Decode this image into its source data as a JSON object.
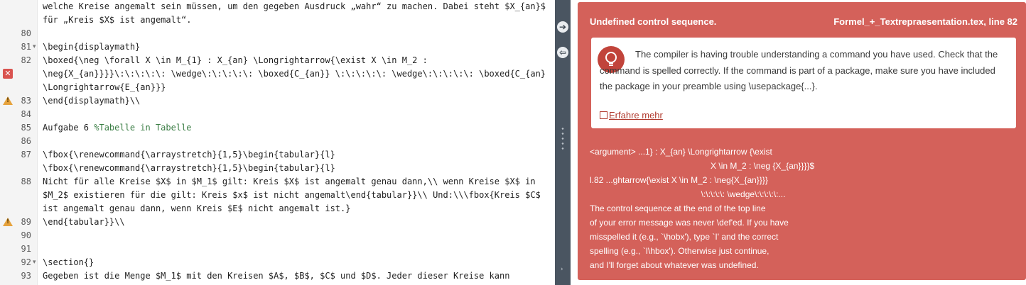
{
  "editor": {
    "lines": [
      {
        "num": "",
        "fold": "",
        "icon": "",
        "code": "welche Kreise angemalt sein müssen, um den gegeben Ausdruck „wahr“ zu machen. Dabei steht $X_{an}$"
      },
      {
        "num": "",
        "fold": "",
        "icon": "",
        "code": "für „Kreis $X$ ist angemalt“."
      },
      {
        "num": "80",
        "fold": "",
        "icon": "",
        "code": ""
      },
      {
        "num": "81",
        "fold": "▾",
        "icon": "",
        "code": "\\begin{displaymath}"
      },
      {
        "num": "82",
        "fold": "",
        "icon": "",
        "code": "\\boxed{\\neg \\forall X \\in M_{1} : X_{an} \\Longrightarrow{\\exist X \\in M_2 :"
      },
      {
        "num": "",
        "fold": "",
        "icon": "error",
        "code": "\\neg{X_{an}}}}\\:\\:\\:\\:\\: \\wedge\\:\\:\\:\\:\\: \\boxed{C_{an}} \\:\\:\\:\\:\\: \\wedge\\:\\:\\:\\:\\: \\boxed{C_{an}"
      },
      {
        "num": "",
        "fold": "",
        "icon": "",
        "code": "\\Longrightarrow{E_{an}}}"
      },
      {
        "num": "83",
        "fold": "",
        "icon": "warning",
        "code": "\\end{displaymath}\\\\"
      },
      {
        "num": "84",
        "fold": "",
        "icon": "",
        "code": ""
      },
      {
        "num": "85",
        "fold": "",
        "icon": "",
        "code": "Aufgabe 6 %Tabelle in Tabelle"
      },
      {
        "num": "86",
        "fold": "",
        "icon": "",
        "code": ""
      },
      {
        "num": "87",
        "fold": "",
        "icon": "",
        "code": "\\fbox{\\renewcommand{\\arraystretch}{1,5}\\begin{tabular}{l}"
      },
      {
        "num": "",
        "fold": "",
        "icon": "",
        "code": "\\fbox{\\renewcommand{\\arraystretch}{1,5}\\begin{tabular}{l}"
      },
      {
        "num": "88",
        "fold": "",
        "icon": "",
        "code": "Nicht für alle Kreise $X$ in $M_1$ gilt: Kreis $X$ ist angemalt genau dann,\\\\ wenn Kreise $X$ in"
      },
      {
        "num": "",
        "fold": "",
        "icon": "",
        "code": "$M_2$ existieren für die gilt: Kreis $x$ ist nicht angemalt\\end{tabular}}\\\\ Und:\\\\\\fbox{Kreis $C$"
      },
      {
        "num": "",
        "fold": "",
        "icon": "",
        "code": "ist angemalt genau dann, wenn Kreis $E$ nicht angemalt ist.}"
      },
      {
        "num": "89",
        "fold": "",
        "icon": "warning",
        "code": "\\end{tabular}}\\\\"
      },
      {
        "num": "90",
        "fold": "",
        "icon": "",
        "code": ""
      },
      {
        "num": "91",
        "fold": "",
        "icon": "",
        "code": ""
      },
      {
        "num": "92",
        "fold": "▾",
        "icon": "",
        "code": "\\section{}"
      },
      {
        "num": "93",
        "fold": "",
        "icon": "",
        "code": "Gegeben ist die Menge $M_1$ mit den Kreisen $A$, $B$, $C$ und $D$. Jeder dieser Kreise kann"
      }
    ]
  },
  "splitter": {
    "expand_icon": "arrow-right-icon",
    "collapse_icon": "arrow-left-icon",
    "expand_glyph": "➔",
    "collapse_glyph": "⇦",
    "handle_glyph": "›"
  },
  "error": {
    "title": "Undefined control sequence.",
    "file": "Formel_+_Textrepraesentation.tex, line 82",
    "hint": "The compiler is having trouble understanding a command you have used. Check that the command is spelled correctly. If the command is part of a package, make sure you have included the package in your preamble using \\usepackage{...}.",
    "learn_more": "Erfahre mehr",
    "raw_lines": [
      "<argument> ...1} : X_{an} \\Longrightarrow {\\exist",
      "                                                   X \\in M_2 : \\neg {X_{an}}}}$",
      "l.82 ...ghtarrow{\\exist X \\in M_2 : \\neg{X_{an}}}}",
      "                                               \\:\\:\\:\\:\\: \\wedge\\:\\:\\:\\:\\:...",
      "The control sequence at the end of the top line",
      "of your error message was never \\def'ed. If you have",
      "misspelled it (e.g., `\\hobx'), type `I' and the correct",
      "spelling (e.g., `I\\hbox'). Otherwise just continue,",
      "and I'll forget about whatever was undefined."
    ],
    "colors": {
      "card": "#d4615a",
      "icon": "#c1443b",
      "link": "#b03a2e"
    },
    "icon": "lightbulb-icon"
  }
}
